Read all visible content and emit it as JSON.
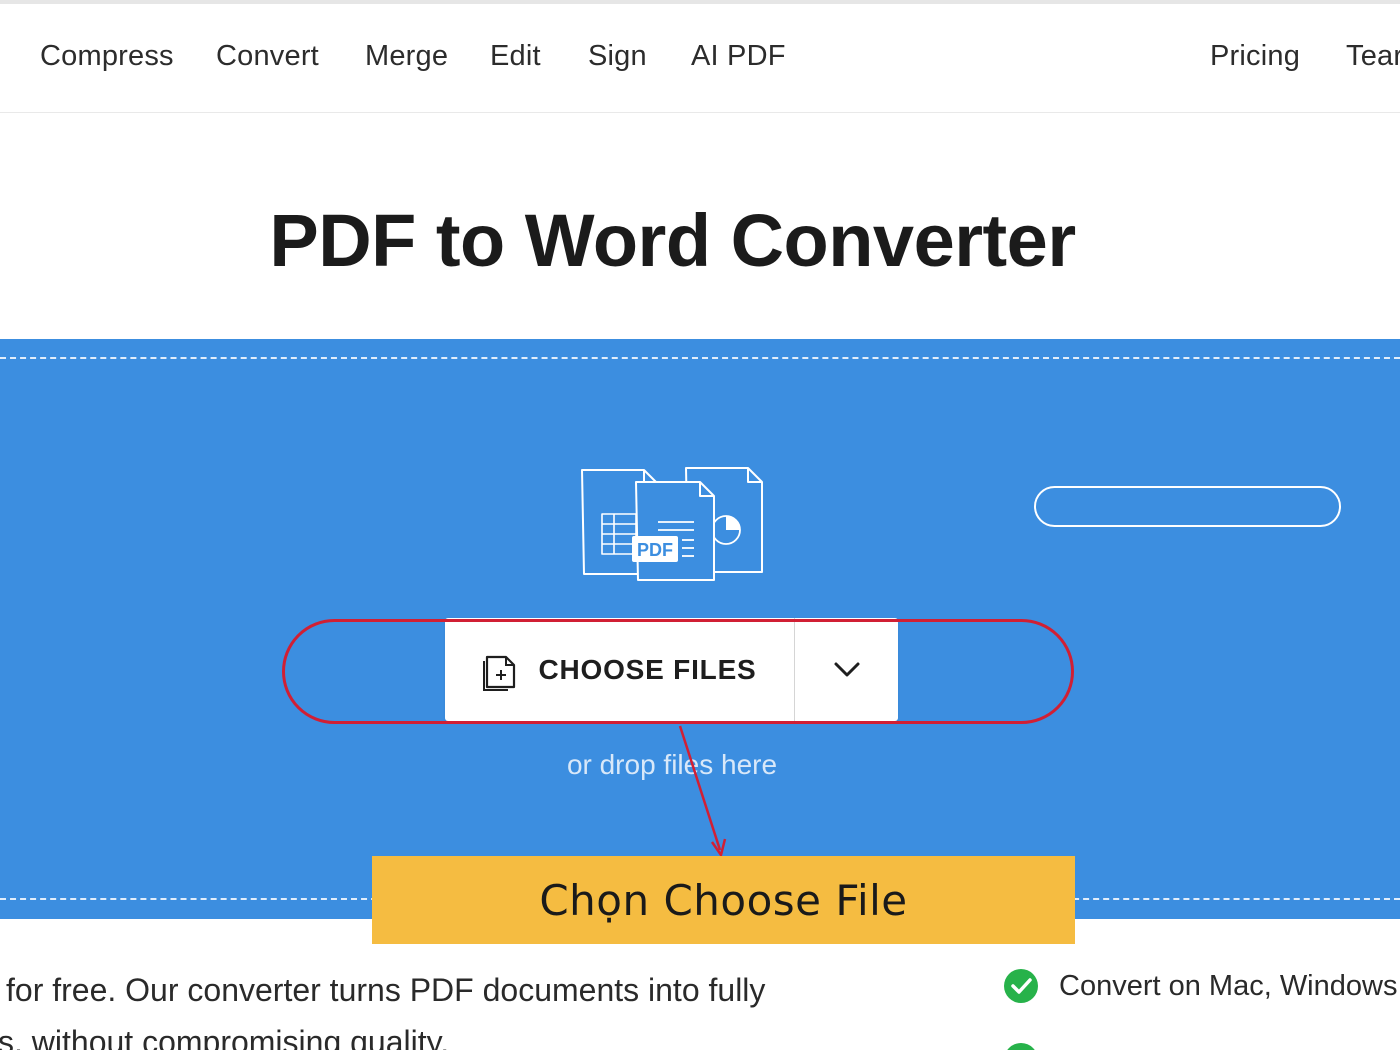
{
  "nav": {
    "items": [
      {
        "label": "Compress"
      },
      {
        "label": "Convert"
      },
      {
        "label": "Merge"
      },
      {
        "label": "Edit"
      },
      {
        "label": "Sign"
      },
      {
        "label": "AI PDF"
      }
    ],
    "pricing": "Pricing",
    "team": "Tear"
  },
  "hero": {
    "title": "PDF to Word Converter"
  },
  "upload": {
    "illustration_badge": "PDF",
    "choose_files": "CHOOSE FILES",
    "drop_hint": "or drop files here",
    "bg_color": "#3c8ee0"
  },
  "annotation": {
    "callout": "Chọn Choose File",
    "ellipse_color": "#d11f34",
    "callout_color": "#f5bc41"
  },
  "content": {
    "line1": "for free. Our converter turns PDF documents into fully",
    "line2": "s, without compromising quality.",
    "feature1": "Convert on Mac, Windows,"
  }
}
